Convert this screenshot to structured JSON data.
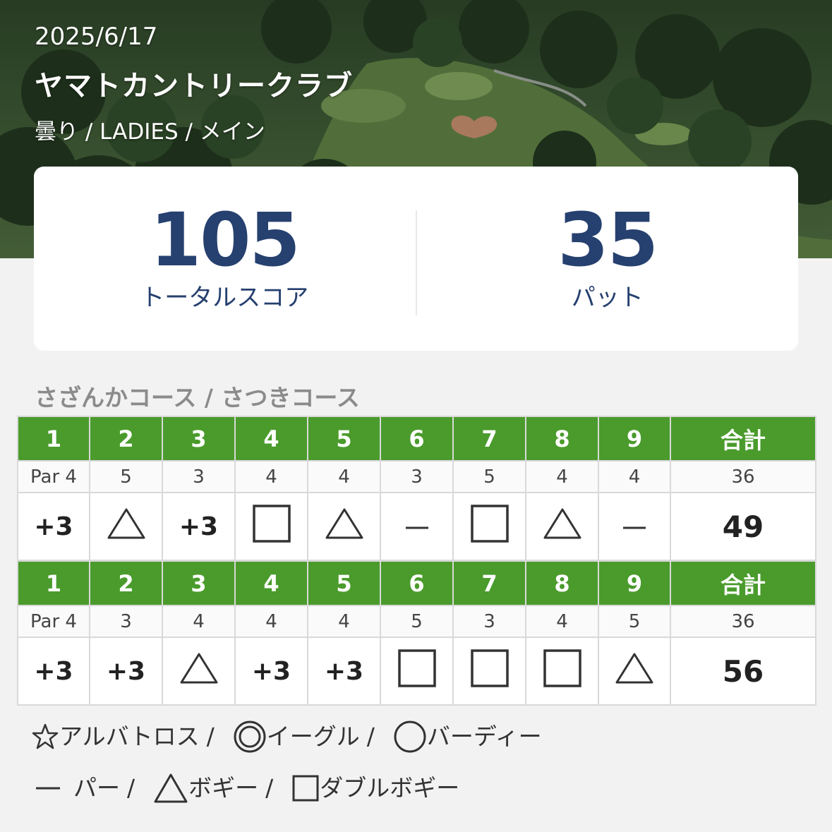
{
  "header": {
    "date": "2025/6/17",
    "club_name": "ヤマトカントリークラブ",
    "conditions": "曇り / LADIES  / メイン"
  },
  "summary": {
    "total_score": "105",
    "total_score_label": "トータルスコア",
    "putts": "35",
    "putts_label": "パット"
  },
  "course_title": "さざんかコース / さつきコース",
  "rounds": [
    {
      "holes": [
        "1",
        "2",
        "3",
        "4",
        "5",
        "6",
        "7",
        "8",
        "9"
      ],
      "total_label": "合計",
      "pars": [
        "Par 4",
        "5",
        "3",
        "4",
        "4",
        "3",
        "5",
        "4",
        "4"
      ],
      "par_total": "36",
      "results": [
        {
          "text": "+3"
        },
        {
          "mark": "triangle-icon"
        },
        {
          "text": "+3"
        },
        {
          "mark": "square-icon"
        },
        {
          "mark": "triangle-icon"
        },
        {
          "mark": "dash-icon"
        },
        {
          "mark": "square-icon"
        },
        {
          "mark": "triangle-icon"
        },
        {
          "mark": "dash-icon"
        }
      ],
      "score_total": "49"
    },
    {
      "holes": [
        "1",
        "2",
        "3",
        "4",
        "5",
        "6",
        "7",
        "8",
        "9"
      ],
      "total_label": "合計",
      "pars": [
        "Par 4",
        "3",
        "4",
        "4",
        "4",
        "5",
        "3",
        "4",
        "5"
      ],
      "par_total": "36",
      "results": [
        {
          "text": "+3"
        },
        {
          "text": "+3"
        },
        {
          "mark": "triangle-icon"
        },
        {
          "text": "+3"
        },
        {
          "text": "+3"
        },
        {
          "mark": "square-icon"
        },
        {
          "mark": "square-icon"
        },
        {
          "mark": "square-icon"
        },
        {
          "mark": "triangle-icon"
        }
      ],
      "score_total": "56"
    }
  ],
  "legend": {
    "albatross": "アルバトロス",
    "eagle": "イーグル",
    "birdie": "バーディー",
    "par": "パー",
    "bogey": "ボギー",
    "double_bogey": "ダブルボギー",
    "separator": "/"
  },
  "colors": {
    "header_green": "#4a9b2c",
    "score_navy": "#26406f",
    "course_title_gray": "#8b8b8b"
  }
}
